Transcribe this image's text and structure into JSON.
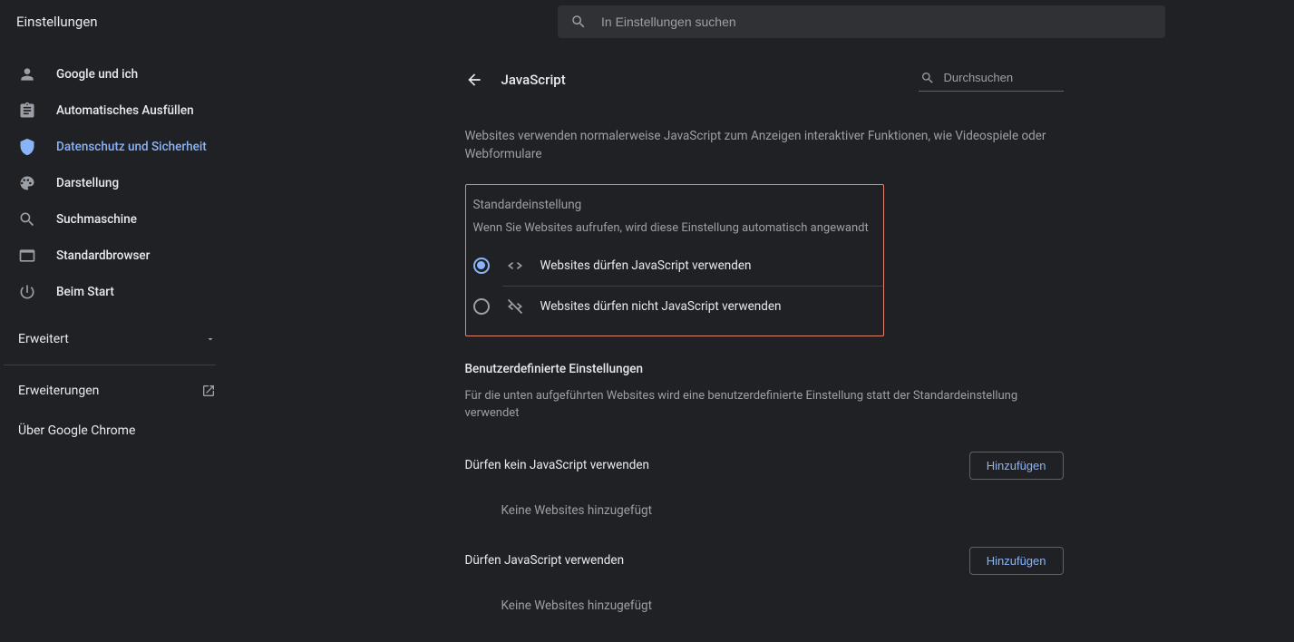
{
  "app": {
    "title": "Einstellungen"
  },
  "search": {
    "placeholder": "In Einstellungen suchen"
  },
  "sidebar": {
    "items": [
      {
        "label": "Google und ich"
      },
      {
        "label": "Automatisches Ausfüllen"
      },
      {
        "label": "Datenschutz und Sicherheit"
      },
      {
        "label": "Darstellung"
      },
      {
        "label": "Suchmaschine"
      },
      {
        "label": "Standardbrowser"
      },
      {
        "label": "Beim Start"
      }
    ],
    "advanced": "Erweitert",
    "extensions": "Erweiterungen",
    "about": "Über Google Chrome"
  },
  "page": {
    "title": "JavaScript",
    "search_placeholder": "Durchsuchen",
    "description": "Websites verwenden normalerweise JavaScript zum Anzeigen interaktiver Funktionen, wie Videospiele oder Webformulare",
    "default_section": {
      "heading": "Standardeinstellung",
      "sub": "Wenn Sie Websites aufrufen, wird diese Einstellung automatisch angewandt",
      "opt_allow": "Websites dürfen JavaScript verwenden",
      "opt_block": "Websites dürfen nicht JavaScript verwenden"
    },
    "custom_section": {
      "heading": "Benutzerdefinierte Einstellungen",
      "sub": "Für die unten aufgeführten Websites wird eine benutzerdefinierte Einstellung statt der Standardeinstellung verwendet"
    },
    "block_list": {
      "title": "Dürfen kein JavaScript verwenden",
      "add": "Hinzufügen",
      "empty": "Keine Websites hinzugefügt"
    },
    "allow_list": {
      "title": "Dürfen JavaScript verwenden",
      "add": "Hinzufügen",
      "empty": "Keine Websites hinzugefügt"
    }
  }
}
